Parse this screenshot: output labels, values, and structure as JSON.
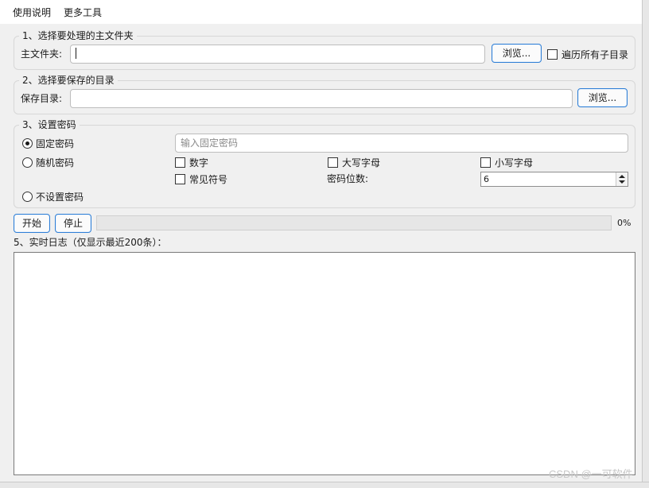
{
  "menu": {
    "items": [
      {
        "label": "使用说明"
      },
      {
        "label": "更多工具"
      }
    ]
  },
  "group1": {
    "title": "1、选择要处理的主文件夹",
    "field_label": "主文件夹:",
    "field_value": "",
    "browse_label": "浏览...",
    "recursive_label": "遍历所有子目录",
    "recursive_checked": false
  },
  "group2": {
    "title": "2、选择要保存的目录",
    "field_label": "保存目录:",
    "field_value": "",
    "browse_label": "浏览..."
  },
  "group3": {
    "title": "3、设置密码",
    "fixed_label": "固定密码",
    "fixed_placeholder": "输入固定密码",
    "random_label": "随机密码",
    "none_label": "不设置密码",
    "selected_mode": "固定密码",
    "options": {
      "digits": "数字",
      "uppercase": "大写字母",
      "lowercase": "小写字母",
      "symbols": "常见符号"
    },
    "length_label": "密码位数:",
    "length_value": "6"
  },
  "controls": {
    "start_label": "开始",
    "stop_label": "停止",
    "progress_percent": 0,
    "progress_text": "0%"
  },
  "log": {
    "title": "5、实时日志（仅显示最近200条）："
  },
  "watermark": "CSDN @一可软件"
}
